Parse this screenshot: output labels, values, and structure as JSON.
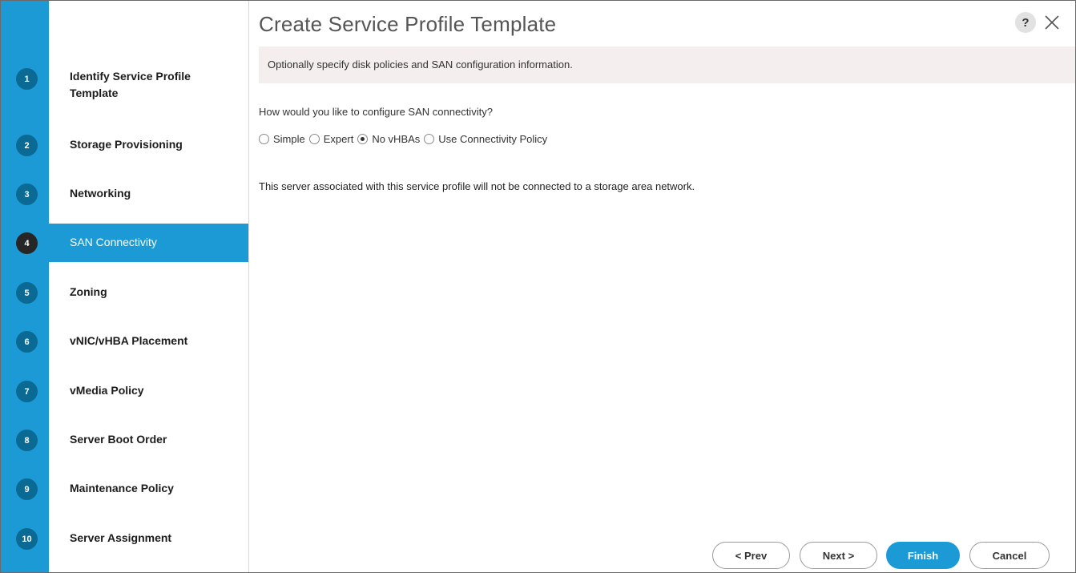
{
  "dialog": {
    "title": "Create Service Profile Template",
    "help_icon": "?",
    "info": "Optionally specify disk policies and SAN configuration information."
  },
  "steps": [
    {
      "number": "1",
      "label": "Identify Service Profile Template"
    },
    {
      "number": "2",
      "label": "Storage Provisioning"
    },
    {
      "number": "3",
      "label": "Networking"
    },
    {
      "number": "4",
      "label": "SAN Connectivity",
      "active": true
    },
    {
      "number": "5",
      "label": "Zoning"
    },
    {
      "number": "6",
      "label": "vNIC/vHBA Placement"
    },
    {
      "number": "7",
      "label": "vMedia Policy"
    },
    {
      "number": "8",
      "label": "Server Boot Order"
    },
    {
      "number": "9",
      "label": "Maintenance Policy"
    },
    {
      "number": "10",
      "label": "Server Assignment"
    }
  ],
  "san": {
    "question": "How would you like to configure SAN connectivity?",
    "options": [
      {
        "label": "Simple",
        "checked": false
      },
      {
        "label": "Expert",
        "checked": false
      },
      {
        "label": "No vHBAs",
        "checked": true
      },
      {
        "label": "Use Connectivity Policy",
        "checked": false
      }
    ],
    "message": "This server associated with this service profile will not be connected to a storage area network."
  },
  "buttons": {
    "prev": "< Prev",
    "next": "Next >",
    "finish": "Finish",
    "cancel": "Cancel"
  },
  "colors": {
    "accent": "#1b9ad6",
    "badge": "#0b6a94",
    "badge_active": "#262626",
    "info_bar": "#f4eeee"
  }
}
